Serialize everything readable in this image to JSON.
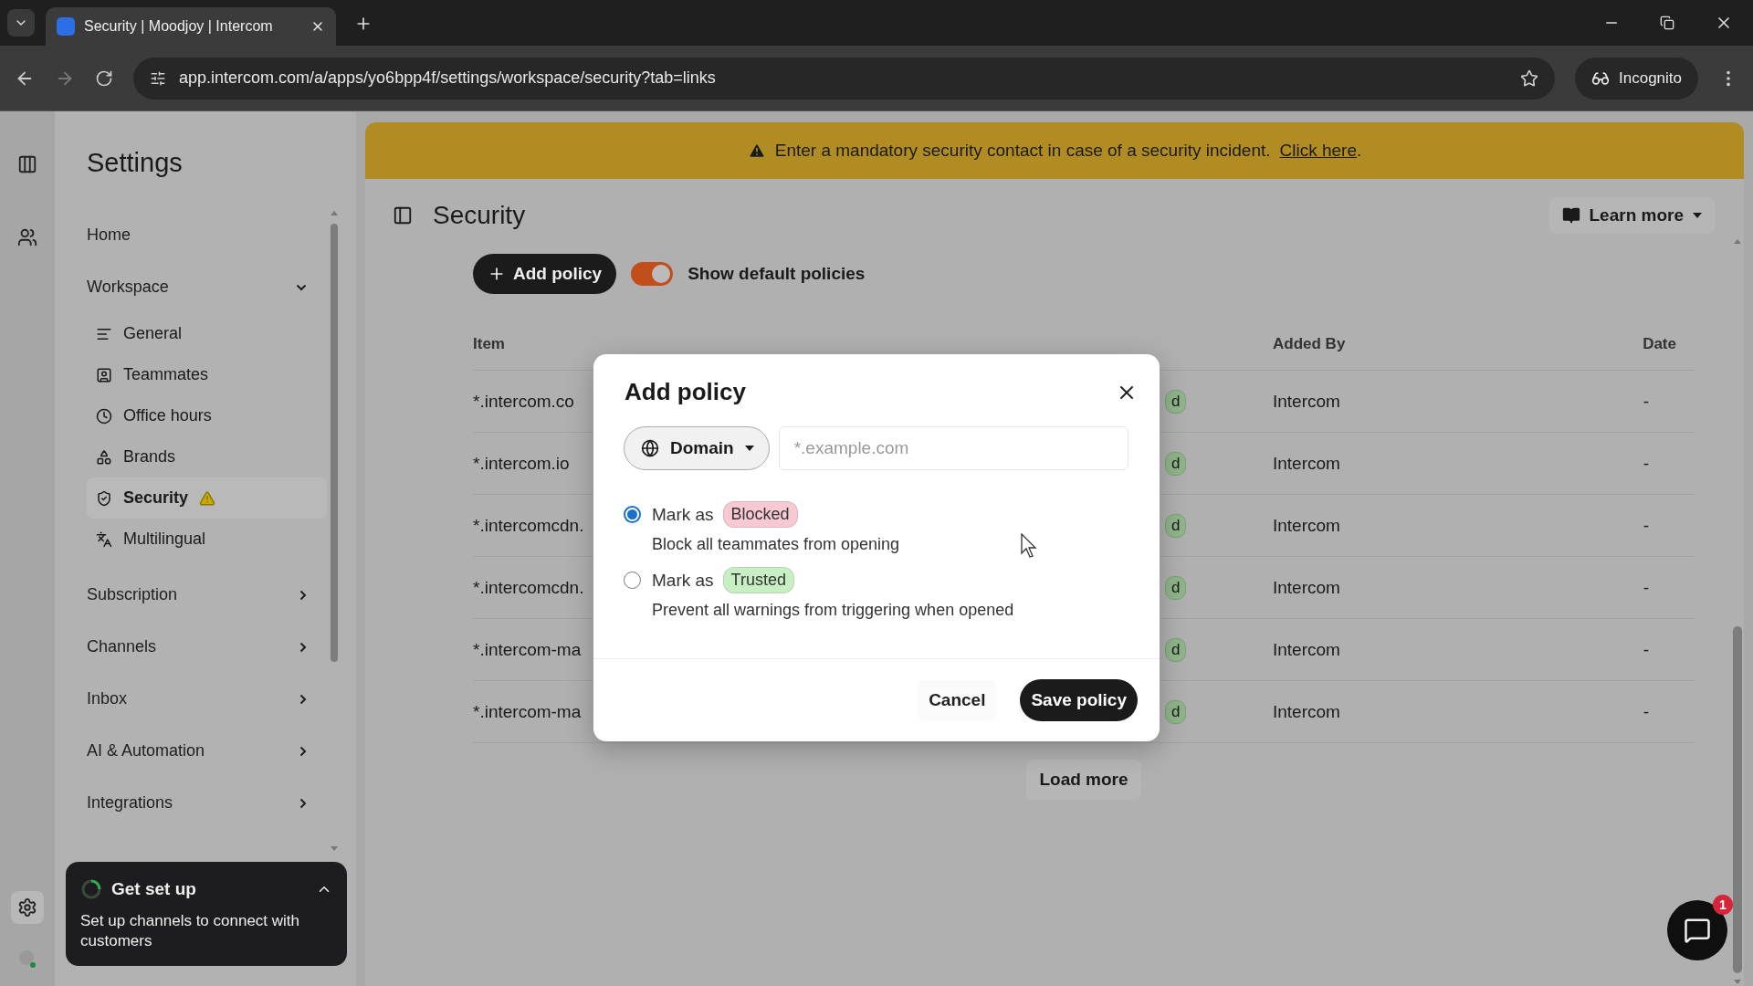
{
  "browser": {
    "tabs": [
      {
        "title": "Security | Moodjoy | Intercom",
        "selected": true
      }
    ],
    "url": "app.intercom.com/a/apps/yo6bpp4f/settings/workspace/security?tab=links",
    "profile": "Incognito"
  },
  "sidebar": {
    "title": "Settings",
    "items": [
      {
        "kind": "link",
        "label": "Home"
      },
      {
        "kind": "section",
        "label": "Workspace",
        "expanded": true,
        "children": [
          {
            "label": "General",
            "selected": false,
            "warning": false
          },
          {
            "label": "Teammates",
            "selected": false,
            "warning": false
          },
          {
            "label": "Office hours",
            "selected": false,
            "warning": false
          },
          {
            "label": "Brands",
            "selected": false,
            "warning": false
          },
          {
            "label": "Security",
            "selected": true,
            "warning": true
          },
          {
            "label": "Multilingual",
            "selected": false,
            "warning": false
          }
        ]
      },
      {
        "kind": "section",
        "label": "Subscription",
        "expanded": false
      },
      {
        "kind": "section",
        "label": "Channels",
        "expanded": false
      },
      {
        "kind": "section",
        "label": "Inbox",
        "expanded": false
      },
      {
        "kind": "section",
        "label": "AI & Automation",
        "expanded": false
      },
      {
        "kind": "section",
        "label": "Integrations",
        "expanded": false
      }
    ]
  },
  "setup_card": {
    "title": "Get set up",
    "text": "Set up channels to connect with customers"
  },
  "banner": {
    "text": "Enter a mandatory security contact in case of a security incident.",
    "link": "Click here",
    "after": "."
  },
  "page": {
    "title": "Security",
    "learn_more": "Learn more",
    "add_button": "Add policy",
    "toggle": {
      "label": "Show default policies",
      "on": true
    }
  },
  "table": {
    "columns": [
      "Item",
      "Added By",
      "Date"
    ],
    "rows": [
      {
        "item": "*.intercom.co",
        "action": "d",
        "added_by": "Intercom",
        "date": "-"
      },
      {
        "item": "*.intercom.io",
        "action": "d",
        "added_by": "Intercom",
        "date": "-"
      },
      {
        "item": "*.intercomcdn.",
        "action": "d",
        "added_by": "Intercom",
        "date": "-"
      },
      {
        "item": "*.intercomcdn.",
        "action": "d",
        "added_by": "Intercom",
        "date": "-"
      },
      {
        "item": "*.intercom-ma",
        "action": "d",
        "added_by": "Intercom",
        "date": "-"
      },
      {
        "item": "*.intercom-ma",
        "action": "d",
        "added_by": "Intercom",
        "date": "-"
      }
    ],
    "load_more": "Load more"
  },
  "modal": {
    "title": "Add policy",
    "type": "Domain",
    "placeholder": "*.example.com",
    "options": [
      {
        "prefix": "Mark as",
        "tag": "Blocked",
        "color": "#f7c9d3",
        "description": "Block all teammates from opening",
        "selected": true
      },
      {
        "prefix": "Mark as",
        "tag": "Trusted",
        "color": "#c8efc4",
        "description": "Prevent all warnings from triggering when opened",
        "selected": false
      }
    ],
    "cancel": "Cancel",
    "save": "Save policy"
  },
  "messenger": {
    "badge": "1"
  }
}
